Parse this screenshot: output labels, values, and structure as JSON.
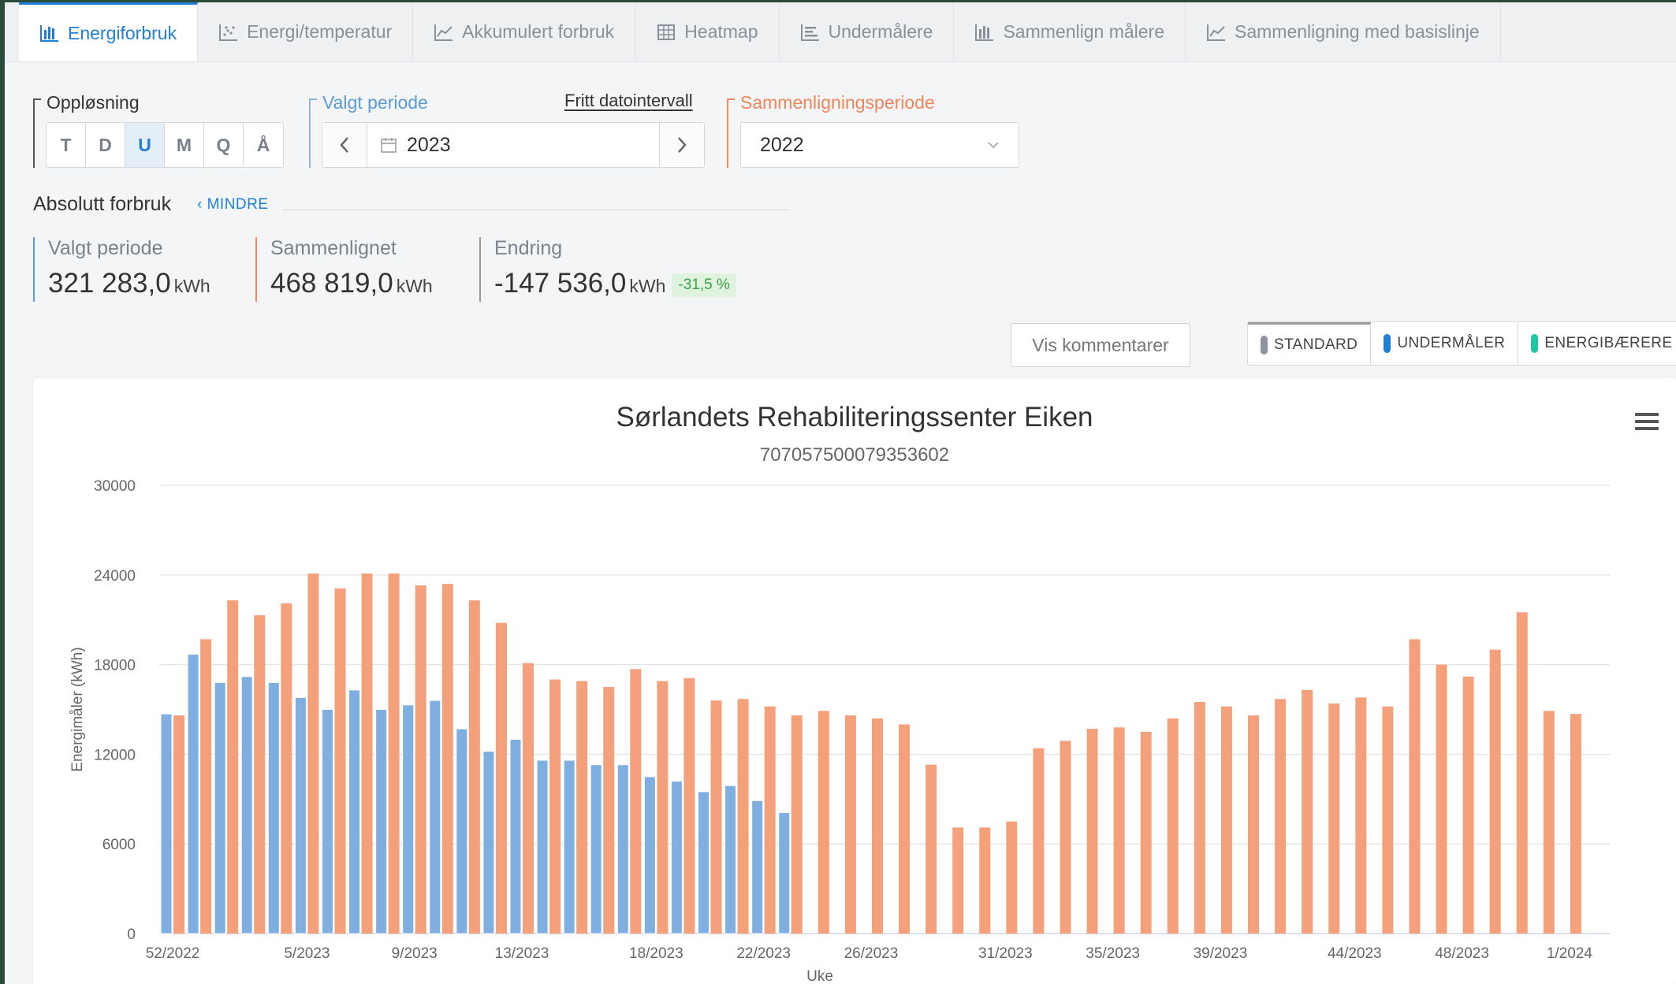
{
  "tabs": [
    {
      "label": "Energiforbruk",
      "active": true,
      "icon": "bar-chart-icon"
    },
    {
      "label": "Energi/temperatur",
      "active": false,
      "icon": "scatter-chart-icon"
    },
    {
      "label": "Akkumulert forbruk",
      "active": false,
      "icon": "line-chart-icon"
    },
    {
      "label": "Heatmap",
      "active": false,
      "icon": "grid-icon"
    },
    {
      "label": "Undermålere",
      "active": false,
      "icon": "list-chart-icon"
    },
    {
      "label": "Sammenlign målere",
      "active": false,
      "icon": "bar-chart-icon"
    },
    {
      "label": "Sammenligning med basislinje",
      "active": false,
      "icon": "line-chart-icon"
    }
  ],
  "resolution": {
    "label": "Oppløsning",
    "options": [
      "T",
      "D",
      "U",
      "M",
      "Q",
      "Å"
    ],
    "selected": "U"
  },
  "period": {
    "label": "Valgt periode",
    "free_interval_link": "Fritt datointervall",
    "value": "2023"
  },
  "comparison": {
    "label": "Sammenligningsperiode",
    "value": "2022"
  },
  "summary": {
    "title": "Absolutt forbruk",
    "toggle": "MINDRE",
    "selected_label": "Valgt periode",
    "selected_value": "321 283,0",
    "compared_label": "Sammenlignet",
    "compared_value": "468 819,0",
    "change_label": "Endring",
    "change_value": "-147 536,0",
    "unit": "kWh",
    "change_pct": "-31,5 %"
  },
  "buttons": {
    "comments": "Vis kommentarer",
    "modes": [
      {
        "label": "STANDARD",
        "color": "#8f939a"
      },
      {
        "label": "UNDERMÅLER",
        "color": "#1f7fd6"
      },
      {
        "label": "ENERGIBÆRERE",
        "color": "#1ec8a5"
      }
    ]
  },
  "colors": {
    "accent": "#1f7fd6",
    "comparison": "#f4a07a",
    "selected_series": "#7faee0"
  },
  "chart_data": {
    "type": "bar",
    "title": "Sørlandets Rehabiliteringssenter Eiken",
    "subtitle": "707057500079353602",
    "xlabel": "Uke",
    "ylabel": "Energimåler (kWh)",
    "ylim": [
      0,
      30000
    ],
    "yticks": [
      0,
      6000,
      12000,
      18000,
      24000,
      30000
    ],
    "grid": true,
    "x_tick_labels": [
      "52/2022",
      "5/2023",
      "9/2023",
      "13/2023",
      "18/2023",
      "22/2023",
      "26/2023",
      "31/2023",
      "35/2023",
      "39/2023",
      "44/2023",
      "48/2023",
      "1/2024"
    ],
    "x_tick_slots": [
      1,
      6,
      10,
      14,
      19,
      23,
      27,
      32,
      36,
      40,
      45,
      49,
      53
    ],
    "num_slots": 54,
    "series": [
      {
        "values": [
          14700,
          18700,
          16800,
          17200,
          16800,
          15800,
          15000,
          16300,
          15000,
          15300,
          15600,
          13700,
          12200,
          13000,
          11600,
          11600,
          11300,
          11300,
          10500,
          10200,
          9500,
          9900,
          8900,
          8100
        ]
      },
      {
        "values": [
          14600,
          19700,
          22300,
          21300,
          22100,
          24100,
          23100,
          24100,
          24100,
          23300,
          23400,
          22300,
          20800,
          18100,
          17000,
          16900,
          16500,
          17700,
          16900,
          17100,
          15600,
          15700,
          15200,
          14600,
          14900,
          14600,
          14400,
          14000,
          11300,
          7100,
          7100,
          7500,
          12400,
          12900,
          13700,
          13800,
          13500,
          14400,
          15500,
          15200,
          14600,
          15700,
          16300,
          15400,
          15800,
          15200,
          19700,
          18000,
          17200,
          19000,
          21500,
          14900,
          14700
        ]
      }
    ]
  }
}
